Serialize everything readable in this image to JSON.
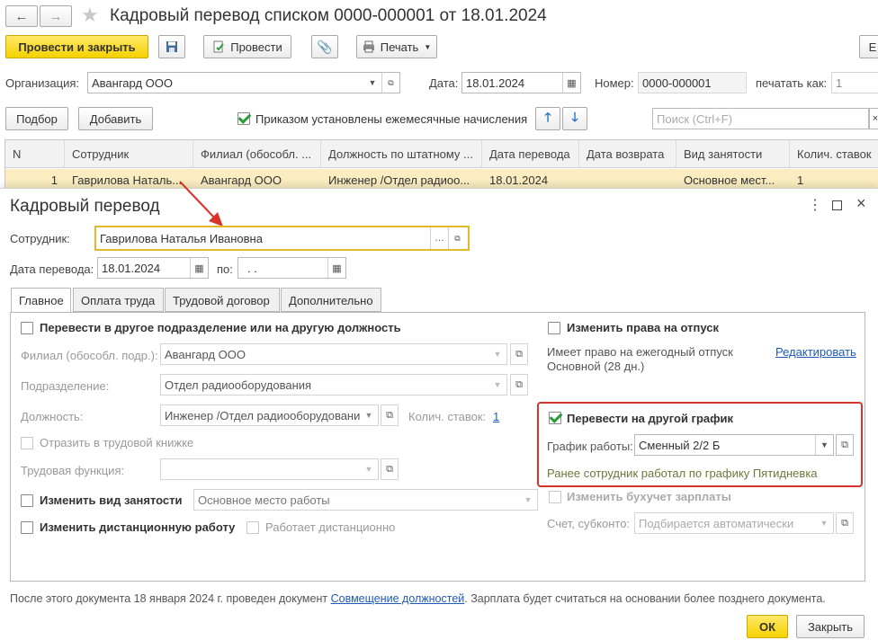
{
  "window": {
    "title": "Кадровый перевод списком 0000-000001 от 18.01.2024"
  },
  "toolbar": {
    "post_close": "Провести и закрыть",
    "post": "Провести",
    "print": "Печать",
    "more": "Е"
  },
  "header": {
    "org_label": "Организация:",
    "org_value": "Авангард ООО",
    "date_label": "Дата:",
    "date_value": "18.01.2024",
    "number_label": "Номер:",
    "number_value": "0000-000001",
    "print_as_label": "печатать как:",
    "print_as_value": "1"
  },
  "list_toolbar": {
    "select": "Подбор",
    "add": "Добавить",
    "monthly_charges": "Приказом установлены ежемесячные начисления",
    "search_placeholder": "Поиск (Ctrl+F)"
  },
  "table": {
    "columns": [
      "N",
      "Сотрудник",
      "Филиал (обособл. ...",
      "Должность по штатному ...",
      "Дата перевода",
      "Дата возврата",
      "Вид занятости",
      "Колич. ставок"
    ],
    "rows": [
      [
        "1",
        "Гаврилова Наталь...",
        "Авангард ООО",
        "Инженер /Отдел радиоо...",
        "18.01.2024",
        "",
        "Основное мест...",
        "1"
      ]
    ]
  },
  "dialog": {
    "title": "Кадровый перевод",
    "employee_label": "Сотрудник:",
    "employee_value": "Гаврилова Наталья Ивановна",
    "transfer_date_label": "Дата перевода:",
    "transfer_date_value": "18.01.2024",
    "to_label": "по:",
    "to_value": ". .",
    "tabs": [
      "Главное",
      "Оплата труда",
      "Трудовой договор",
      "Дополнительно"
    ],
    "main": {
      "transfer_dept": "Перевести в другое подразделение или на другую должность",
      "branch_label": "Филиал (обособл. подр.):",
      "branch_value": "Авангард ООО",
      "dept_label": "Подразделение:",
      "dept_value": "Отдел радиооборудования",
      "position_label": "Должность:",
      "position_value": "Инженер /Отдел радиооборудовани",
      "rates_label": "Колич. ставок:",
      "rates_value": "1",
      "workbook": "Отразить в трудовой книжке",
      "labor_function_label": "Трудовая функция:",
      "labor_function_value": "",
      "change_employment": "Изменить вид занятости",
      "employment_value": "Основное место работы",
      "change_remote": "Изменить дистанционную работу",
      "works_remote": "Работает дистанционно",
      "change_vacation": "Изменить права на отпуск",
      "vacation_info_1": "Имеет право на ежегодный отпуск",
      "vacation_info_2": "Основной (28 дн.)",
      "edit_link": "Редактировать",
      "transfer_schedule": "Перевести на другой график",
      "schedule_label": "График работы:",
      "schedule_value": "Сменный 2/2 Б",
      "schedule_note": "Ранее сотрудник работал по графику Пятидневка",
      "change_accounting": "Изменить бухучет зарплаты",
      "account_label": "Счет, субконто:",
      "account_value": "Подбирается автоматически"
    },
    "footer_text_1": "После этого документа 18 января 2024 г. проведен документ",
    "footer_link": "Совмещение должностей",
    "footer_text_2": ". Зарплата будет считаться на основании более позднего документа.",
    "ok": "ОК",
    "close": "Закрыть"
  },
  "colors": {
    "accent_yellow": "#f5d200",
    "highlight_border": "#e5b82b",
    "red_frame": "#d9342b",
    "row_highlight": "#fbedc0"
  }
}
